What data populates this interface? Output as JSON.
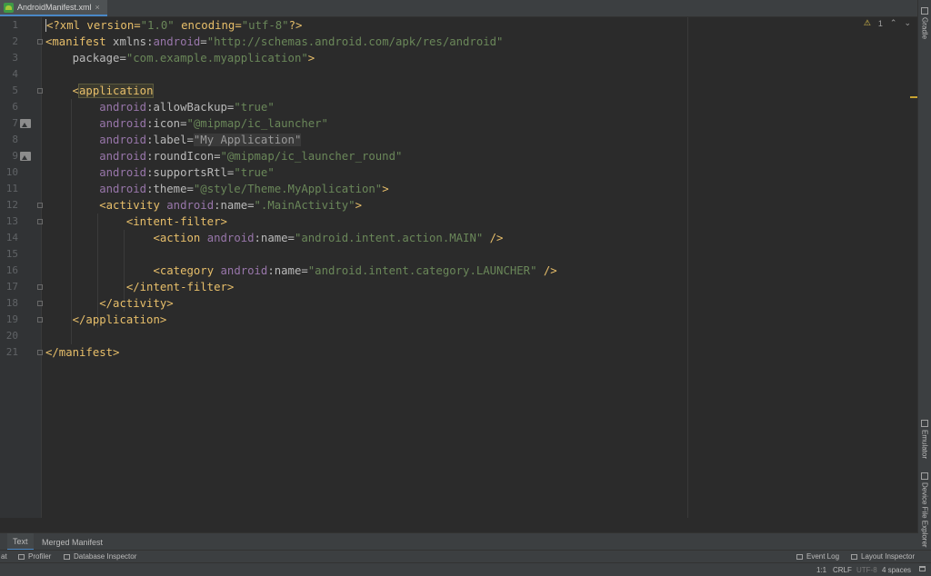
{
  "tab": {
    "file_name": "AndroidManifest.xml",
    "close": "×"
  },
  "gutter": {
    "line_numbers": [
      "1",
      "2",
      "3",
      "4",
      "5",
      "6",
      "7",
      "8",
      "9",
      "10",
      "11",
      "12",
      "13",
      "14",
      "15",
      "16",
      "17",
      "18",
      "19",
      "20",
      "21"
    ]
  },
  "code": {
    "l1": {
      "a": "<?xml version=",
      "b": "\"1.0\"",
      "c": " encoding=",
      "d": "\"utf-8\"",
      "e": "?>"
    },
    "l2": {
      "a": "<manifest ",
      "b": "xmlns:",
      "c": "android",
      "d": "=",
      "e": "\"http://schemas.android.com/apk/res/android\""
    },
    "l3": {
      "a": "package",
      "b": "=",
      "c": "\"com.example.myapplication\"",
      "d": ">"
    },
    "l5": {
      "a": "<",
      "b": "application"
    },
    "l6": {
      "a": "android",
      "b": ":allowBackup=",
      "c": "\"true\""
    },
    "l7": {
      "a": "android",
      "b": ":icon=",
      "c": "\"@mipmap/ic_launcher\""
    },
    "l8": {
      "a": "android",
      "b": ":label=",
      "c": "\"My Application\""
    },
    "l9": {
      "a": "android",
      "b": ":roundIcon=",
      "c": "\"@mipmap/ic_launcher_round\""
    },
    "l10": {
      "a": "android",
      "b": ":supportsRtl=",
      "c": "\"true\""
    },
    "l11": {
      "a": "android",
      "b": ":theme=",
      "c": "\"@style/Theme.MyApplication\"",
      "d": ">"
    },
    "l12": {
      "a": "<activity ",
      "b": "android",
      "c": ":name=",
      "d": "\".MainActivity\"",
      "e": ">"
    },
    "l13": {
      "a": "<intent-filter>"
    },
    "l14": {
      "a": "<action ",
      "b": "android",
      "c": ":name=",
      "d": "\"android.intent.action.MAIN\"",
      "e": " />"
    },
    "l16": {
      "a": "<category ",
      "b": "android",
      "c": ":name=",
      "d": "\"android.intent.category.LAUNCHER\"",
      "e": " />"
    },
    "l17": {
      "a": "</intent-filter>"
    },
    "l18": {
      "a": "</activity>"
    },
    "l19": {
      "a": "</application>"
    },
    "l21": {
      "a": "</manifest>"
    }
  },
  "inspection": {
    "warning_icon": "⚠",
    "count": "1",
    "up": "⌃",
    "down": "⌄"
  },
  "right_sidebar": {
    "gradle": "Gradle",
    "emulator": "Emulator",
    "device_file_explorer": "Device File Explorer"
  },
  "bottom_tabs": {
    "text": "Text",
    "merged_manifest": "Merged Manifest"
  },
  "tool_strip": {
    "cut_label": "at",
    "profiler": "Profiler",
    "database_inspector": "Database Inspector",
    "event_log": "Event Log",
    "layout_inspector": "Layout Inspector"
  },
  "status": {
    "position": "1:1",
    "line_sep": "CRLF",
    "encoding": "UTF-8",
    "indent": "4 spaces"
  },
  "colors": {
    "background": "#2b2b2b",
    "tag": "#e8bf6a",
    "string": "#6a8759",
    "namespace": "#9876aa",
    "accent": "#4a88c7"
  }
}
